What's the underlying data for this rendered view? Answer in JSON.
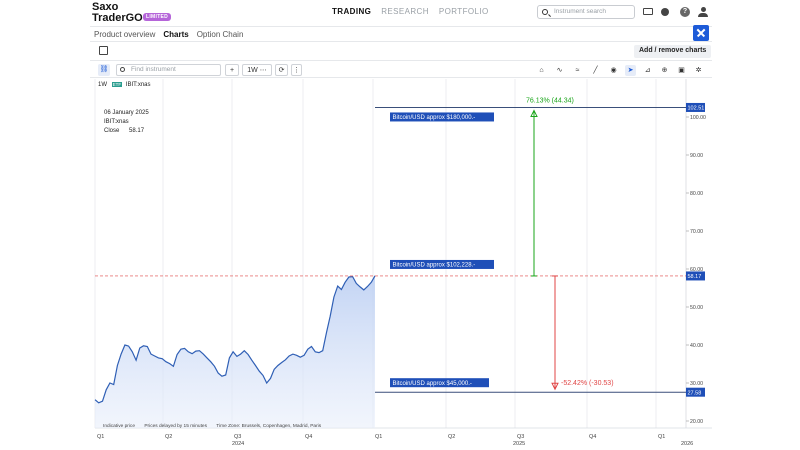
{
  "brand": {
    "line1": "Saxo",
    "line2": "TraderGO",
    "badge": "LIMITED"
  },
  "nav": {
    "trading": "TRADING",
    "research": "RESEARCH",
    "portfolio": "PORTFOLIO"
  },
  "search": {
    "placeholder": "Instrument search"
  },
  "subnav": {
    "product_overview": "Product overview",
    "charts": "Charts",
    "option_chain": "Option Chain"
  },
  "add_remove": "Add / remove charts",
  "toolbar": {
    "find_placeholder": "Find instrument",
    "add": "+",
    "interval": "1W ⋯",
    "refresh": "⟳",
    "more": "⋮"
  },
  "legend": {
    "interval": "1W",
    "etf": "ETF",
    "symbol": "IBIT:xnas",
    "date": "06 January 2025",
    "symbol2": "IBIT:xnas",
    "close_label": "Close",
    "close_value": "58.17"
  },
  "annotations": {
    "level_180k": "Bitcoin/USD approx $180,000.-",
    "level_102k": "Bitcoin/USD approx $102,228.-",
    "level_45k": "Bitcoin/USD approx $45,000.-",
    "up_label": "76.13% (44.34)",
    "down_label": "-52.42% (-30.53)"
  },
  "price_tags": {
    "top": "102.51",
    "current": "58.17",
    "bottom": "27.58"
  },
  "y_ticks": [
    "100.00",
    "90.00",
    "80.00",
    "70.00",
    "60.00",
    "50.00",
    "40.00",
    "30.00",
    "20.00"
  ],
  "x_quarters": [
    "Q1",
    "Q2",
    "Q3",
    "Q4",
    "Q1",
    "Q2",
    "Q3",
    "Q4",
    "Q1"
  ],
  "x_years": [
    "2024",
    "2025",
    "2026"
  ],
  "footer": {
    "indicative": "Indicative price",
    "delay": "Prices delayed by 15 minutes",
    "tz": "Time Zone: Brussels, Copenhagen, Madrid, Paris"
  },
  "colors": {
    "accent": "#1d5bd8",
    "line": "#2f5fb5",
    "up": "#1aa51a",
    "down": "#e04545",
    "label_bg": "#1f4fb8"
  },
  "price_series": [
    25.6,
    24.8,
    25.2,
    28.2,
    30.0,
    29.6,
    34.6,
    37.6,
    40.0,
    39.7,
    38.2,
    36.0,
    39.2,
    39.8,
    39.6,
    37.6,
    37.1,
    36.6,
    36.4,
    35.6,
    35.1,
    34.4,
    37.5,
    38.9,
    39.1,
    38.2,
    37.7,
    38.4,
    38.5,
    37.6,
    36.6,
    35.6,
    34.4,
    32.6,
    31.8,
    32.1,
    36.6,
    38.2,
    37.0,
    37.6,
    38.5,
    37.5,
    36.0,
    34.6,
    33.1,
    32.0,
    30.0,
    31.2,
    33.6,
    34.6,
    35.4,
    36.1,
    37.1,
    37.6,
    37.3,
    36.8,
    37.3,
    38.9,
    39.6,
    38.2,
    38.0,
    38.5,
    43.3,
    47.6,
    52.6,
    55.5,
    54.6,
    56.5,
    57.9,
    58.0,
    56.2,
    55.3,
    54.5,
    55.4,
    56.5,
    58.2
  ]
}
